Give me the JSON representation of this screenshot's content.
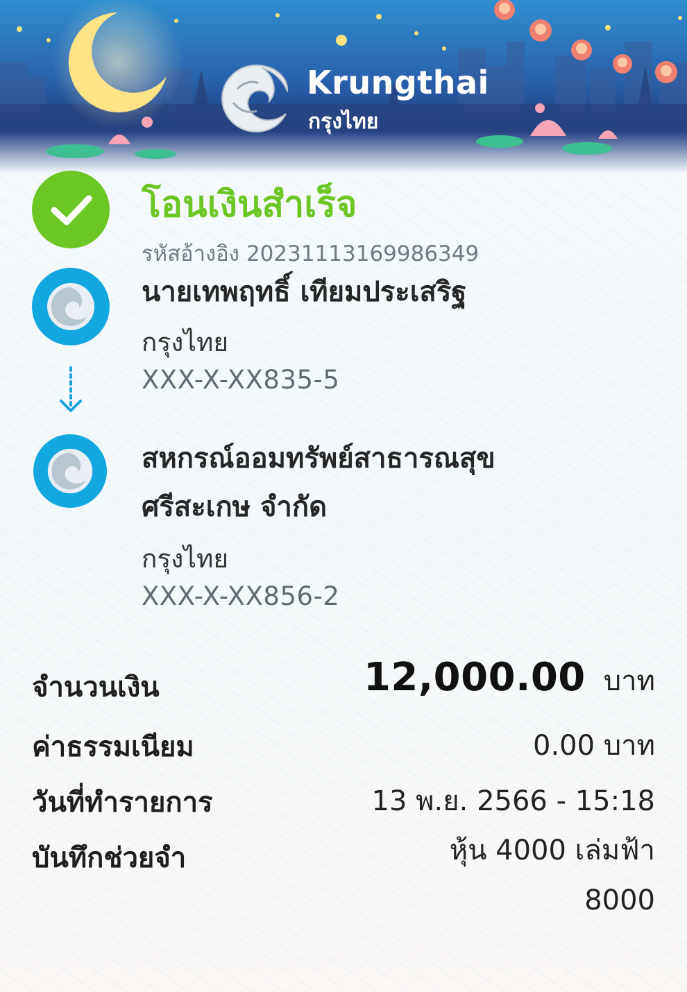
{
  "header": {
    "brand_en": "Krungthai",
    "brand_th": "กรุงไทย"
  },
  "status": {
    "title": "โอนเงินสำเร็จ",
    "ref_label": "รหัสอ้างอิง",
    "ref_number": "2023111316998634​9"
  },
  "sender": {
    "name": "นายเทพฤทธิ์ เทียมประเสริฐ",
    "bank": "กรุงไทย",
    "account": "XXX-X-XX835-5"
  },
  "receiver": {
    "name_line1": "สหกรณ์ออมทรัพย์สาธารณสุข",
    "name_line2": "ศรีสะเกษ จำกัด",
    "bank": "กรุงไทย",
    "account": "XXX-X-XX856-2"
  },
  "details": {
    "amount_label": "จำนวนเงิน",
    "amount_value": "12,000.00",
    "amount_unit": "บาท",
    "fee_label": "ค่าธรรมเนียม",
    "fee_value": "0.00 บาท",
    "date_label": "วันที่ทำรายการ",
    "date_value": "13 พ.ย. 2566 - 15:18",
    "memo_label": "บันทึกช่วยจำ",
    "memo_line1": "หุ้น 4000 เล่มฟ้า",
    "memo_line2": "8000"
  },
  "colors": {
    "success_green": "#6cc724",
    "bank_blue": "#13a7e0",
    "banner_dark": "#1f3a78"
  }
}
